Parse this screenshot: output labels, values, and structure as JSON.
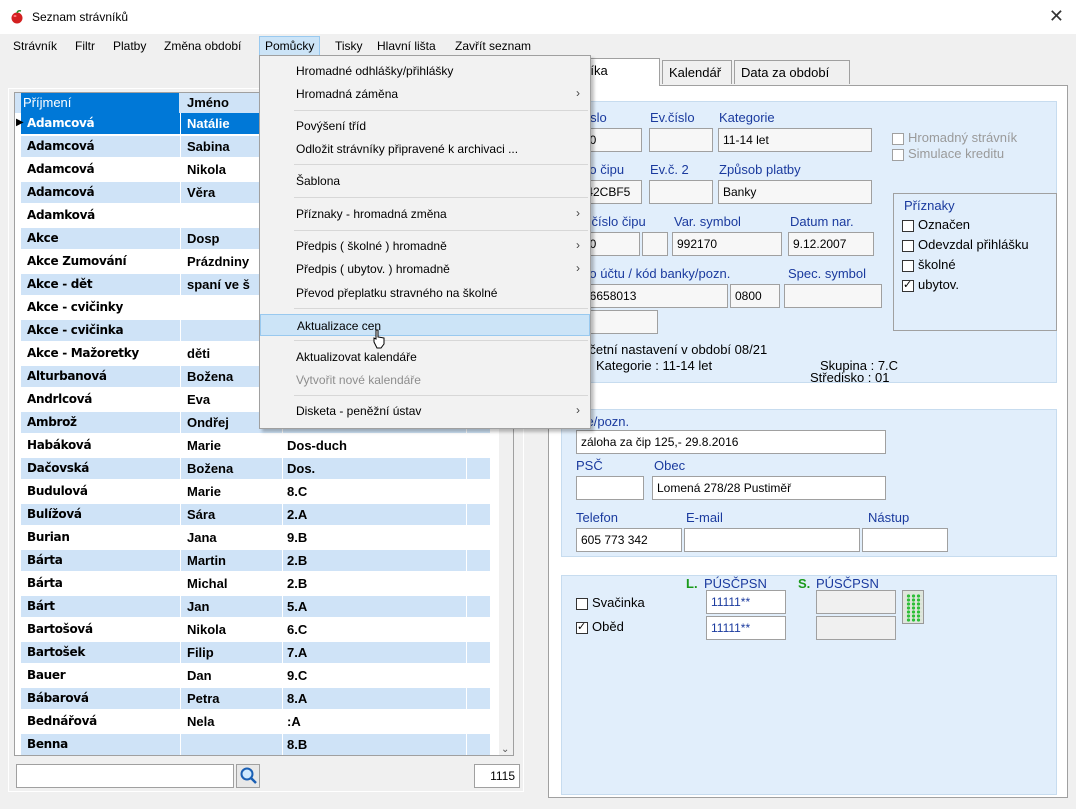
{
  "window": {
    "title": "Seznam strávníků"
  },
  "menubar": [
    "Strávník",
    "Filtr",
    "Platby",
    "Změna období",
    "Pomůcky",
    "Tisky",
    "Hlavní lišta",
    "Zavřít seznam"
  ],
  "grid": {
    "headers": [
      "Příjmení",
      "Jméno"
    ],
    "rows": [
      [
        "Adamcová",
        "Natálie",
        ""
      ],
      [
        "Adamcová",
        "Sabina",
        ""
      ],
      [
        "Adamcová",
        "Nikola",
        ""
      ],
      [
        "Adamcová",
        "Věra",
        ""
      ],
      [
        "Adamková",
        "",
        ""
      ],
      [
        "Akce",
        "Dosp",
        ""
      ],
      [
        "Akce Zumování",
        "Prázdniny",
        ""
      ],
      [
        "Akce - dět",
        "spaní ve š",
        ""
      ],
      [
        "Akce - cvičinky",
        "",
        ""
      ],
      [
        "Akce - cvičinka",
        "",
        ""
      ],
      [
        "Akce - Mažoretky",
        "děti",
        ""
      ],
      [
        "Alturbanová",
        "Božena",
        ""
      ],
      [
        "Andrlcová",
        "Eva",
        ""
      ],
      [
        "Ambrož",
        "Ondřej",
        ""
      ],
      [
        "Habáková",
        "Marie",
        "Dos-duch"
      ],
      [
        "Dačovská",
        "Božena",
        "Dos."
      ],
      [
        "Budulová",
        "Marie",
        "8.C"
      ],
      [
        "Bulížová",
        "Sára",
        "2.A"
      ],
      [
        "Burian",
        "Jana",
        "9.B"
      ],
      [
        "Bárta",
        "Martin",
        "2.B"
      ],
      [
        "Bárta",
        "Michal",
        "2.B"
      ],
      [
        "Bárt",
        "Jan",
        "5.A"
      ],
      [
        "Bartošová",
        "Nikola",
        "6.C"
      ],
      [
        "Bartošek",
        "Filip",
        "7.A"
      ],
      [
        "Bauer",
        "Dan",
        "9.C"
      ],
      [
        "Bábarová",
        "Petra",
        "8.A"
      ],
      [
        "Bednářová",
        "Nela",
        ":A"
      ],
      [
        "Benna",
        "",
        "8.B"
      ]
    ],
    "count": "1115"
  },
  "menu": {
    "items": [
      {
        "label": "Hromadné odhlášky/přihlášky",
        "arrow": false
      },
      {
        "label": "Hromadná záměna",
        "arrow": true
      },
      {
        "label": "Povýšení tříd",
        "arrow": false
      },
      {
        "label": "Odložit strávníky připravené k archivaci ...",
        "arrow": false
      },
      {
        "label": "Šablona",
        "arrow": false
      },
      {
        "label": "Příznaky - hromadná změna",
        "arrow": true
      },
      {
        "label": "Předpis ( školné ) hromadně",
        "arrow": true
      },
      {
        "label": "Předpis ( ubytov. ) hromadně",
        "arrow": true
      },
      {
        "label": "Převod přeplatku stravného na školné",
        "arrow": false
      },
      {
        "label": "Aktualizace cen",
        "arrow": false
      },
      {
        "label": "Aktualizovat kalendáře",
        "arrow": false
      },
      {
        "label": "Vytvořit nové kalendáře",
        "arrow": false
      },
      {
        "label": "Disketa - peněžní ústav",
        "arrow": true
      }
    ]
  },
  "tabs": [
    "strávníka",
    "Kalendář",
    "Data za období"
  ],
  "detail": {
    "labels": {
      "cislo": "číslo",
      "evcislo": "Ev.číslo",
      "kategorie": "Kategorie",
      "cip": "slo čipu",
      "ev2": "Ev.č. 2",
      "zpusob": "Způsob platby",
      "varcip": "ř. číslo čipu",
      "varsym": "Var. symbol",
      "datum": "Datum nar.",
      "ucet": "slo účtu / kód banky/pozn.",
      "spec": "Spec. symbol",
      "pozn": "ce/pozn.",
      "psc": "PSČ",
      "obec": "Obec",
      "telefon": "Telefon",
      "email": "E-mail",
      "nastup": "Nástup"
    },
    "values": {
      "cislo": "70",
      "kategorie": "11-14 let",
      "cip": ".42CBF5",
      "zpusob": "Banky",
      "varcip": "70",
      "varsym": "992170",
      "datum": "9.12.2007",
      "ucet": "46658013",
      "banka": "0800",
      "pozn": "záloha za čip 125,- 29.8.2016",
      "obec": "Lomená 278/28 Pustiměř",
      "telefon": "605 773 342"
    },
    "hromadny": "Hromadný strávník",
    "simulace": "Simulace kreditu",
    "priznaky_title": "Příznaky",
    "priznaky": [
      {
        "label": "Označen",
        "checked": false
      },
      {
        "label": "Odevzdal přihlášku",
        "checked": false
      },
      {
        "label": "školné",
        "checked": false
      },
      {
        "label": "ubytov.",
        "checked": true
      }
    ],
    "ucetni": "Účetní nastavení v období 08/21",
    "kat_line": "Kategorie : 11-14 let",
    "skupina": "Skupina : 7.C",
    "stredisko": "Středisko : 01",
    "meals_header_l": "L.",
    "meals_header_l_text": "PÚSČPSN",
    "meals_header_s": "S.",
    "meals_header_s_text": "PÚSČPSN",
    "meals": [
      {
        "label": "Svačinka",
        "checked": false,
        "code": "11111**"
      },
      {
        "label": "Oběd",
        "checked": true,
        "code": "11111**"
      }
    ]
  }
}
